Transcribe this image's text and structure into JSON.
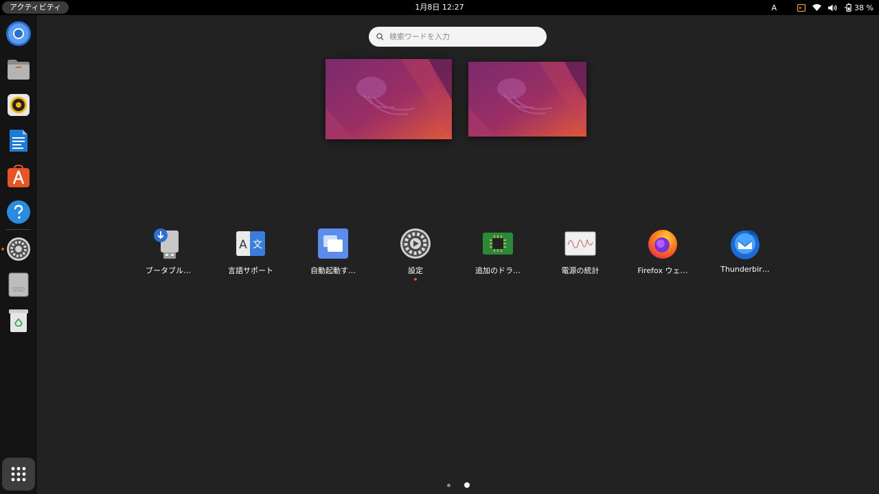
{
  "topbar": {
    "activities_label": "アクティビティ",
    "clock": "1月8日  12:27",
    "ime_indicator": "A",
    "battery_percent": "38 %",
    "tray_icons": [
      "terminal-notification-icon",
      "wifi-icon",
      "volume-icon",
      "battery-icon"
    ]
  },
  "dock": {
    "items": [
      {
        "name": "chromium",
        "icon": "chromium-icon"
      },
      {
        "name": "files",
        "icon": "folder-icon"
      },
      {
        "name": "rhythmbox",
        "icon": "speaker-icon"
      },
      {
        "name": "writer",
        "icon": "document-icon"
      },
      {
        "name": "software",
        "icon": "app-store-icon"
      },
      {
        "name": "help",
        "icon": "help-icon"
      },
      {
        "name": "settings",
        "icon": "gear-icon"
      },
      {
        "name": "ssd",
        "icon": "drive-icon",
        "badge": "SSD"
      },
      {
        "name": "trash",
        "icon": "trash-icon"
      }
    ],
    "show_apps_icon": "grid-icon"
  },
  "search": {
    "placeholder": "検索ワードを入力"
  },
  "workspaces": [
    {
      "name": "workspace-1"
    },
    {
      "name": "workspace-2"
    }
  ],
  "apps": [
    {
      "label": "ブータブル…",
      "icon": "usb-creator-icon",
      "running": false
    },
    {
      "label": "言語サポート",
      "icon": "language-icon",
      "running": false
    },
    {
      "label": "自動起動す…",
      "icon": "startup-apps-icon",
      "running": false
    },
    {
      "label": "設定",
      "icon": "settings-icon",
      "running": true
    },
    {
      "label": "追加のドラ…",
      "icon": "chip-icon",
      "running": false
    },
    {
      "label": "電源の統計",
      "icon": "power-stats-icon",
      "running": false
    },
    {
      "label": "Firefox ウェ…",
      "icon": "firefox-icon",
      "running": false
    },
    {
      "label": "Thunderbir…",
      "icon": "thunderbird-icon",
      "running": false
    }
  ],
  "pagination": {
    "pages": 2,
    "current": 2
  },
  "colors": {
    "accent": "#e95420",
    "background": "#222222",
    "dock": "#141414",
    "topbar": "#000000"
  }
}
